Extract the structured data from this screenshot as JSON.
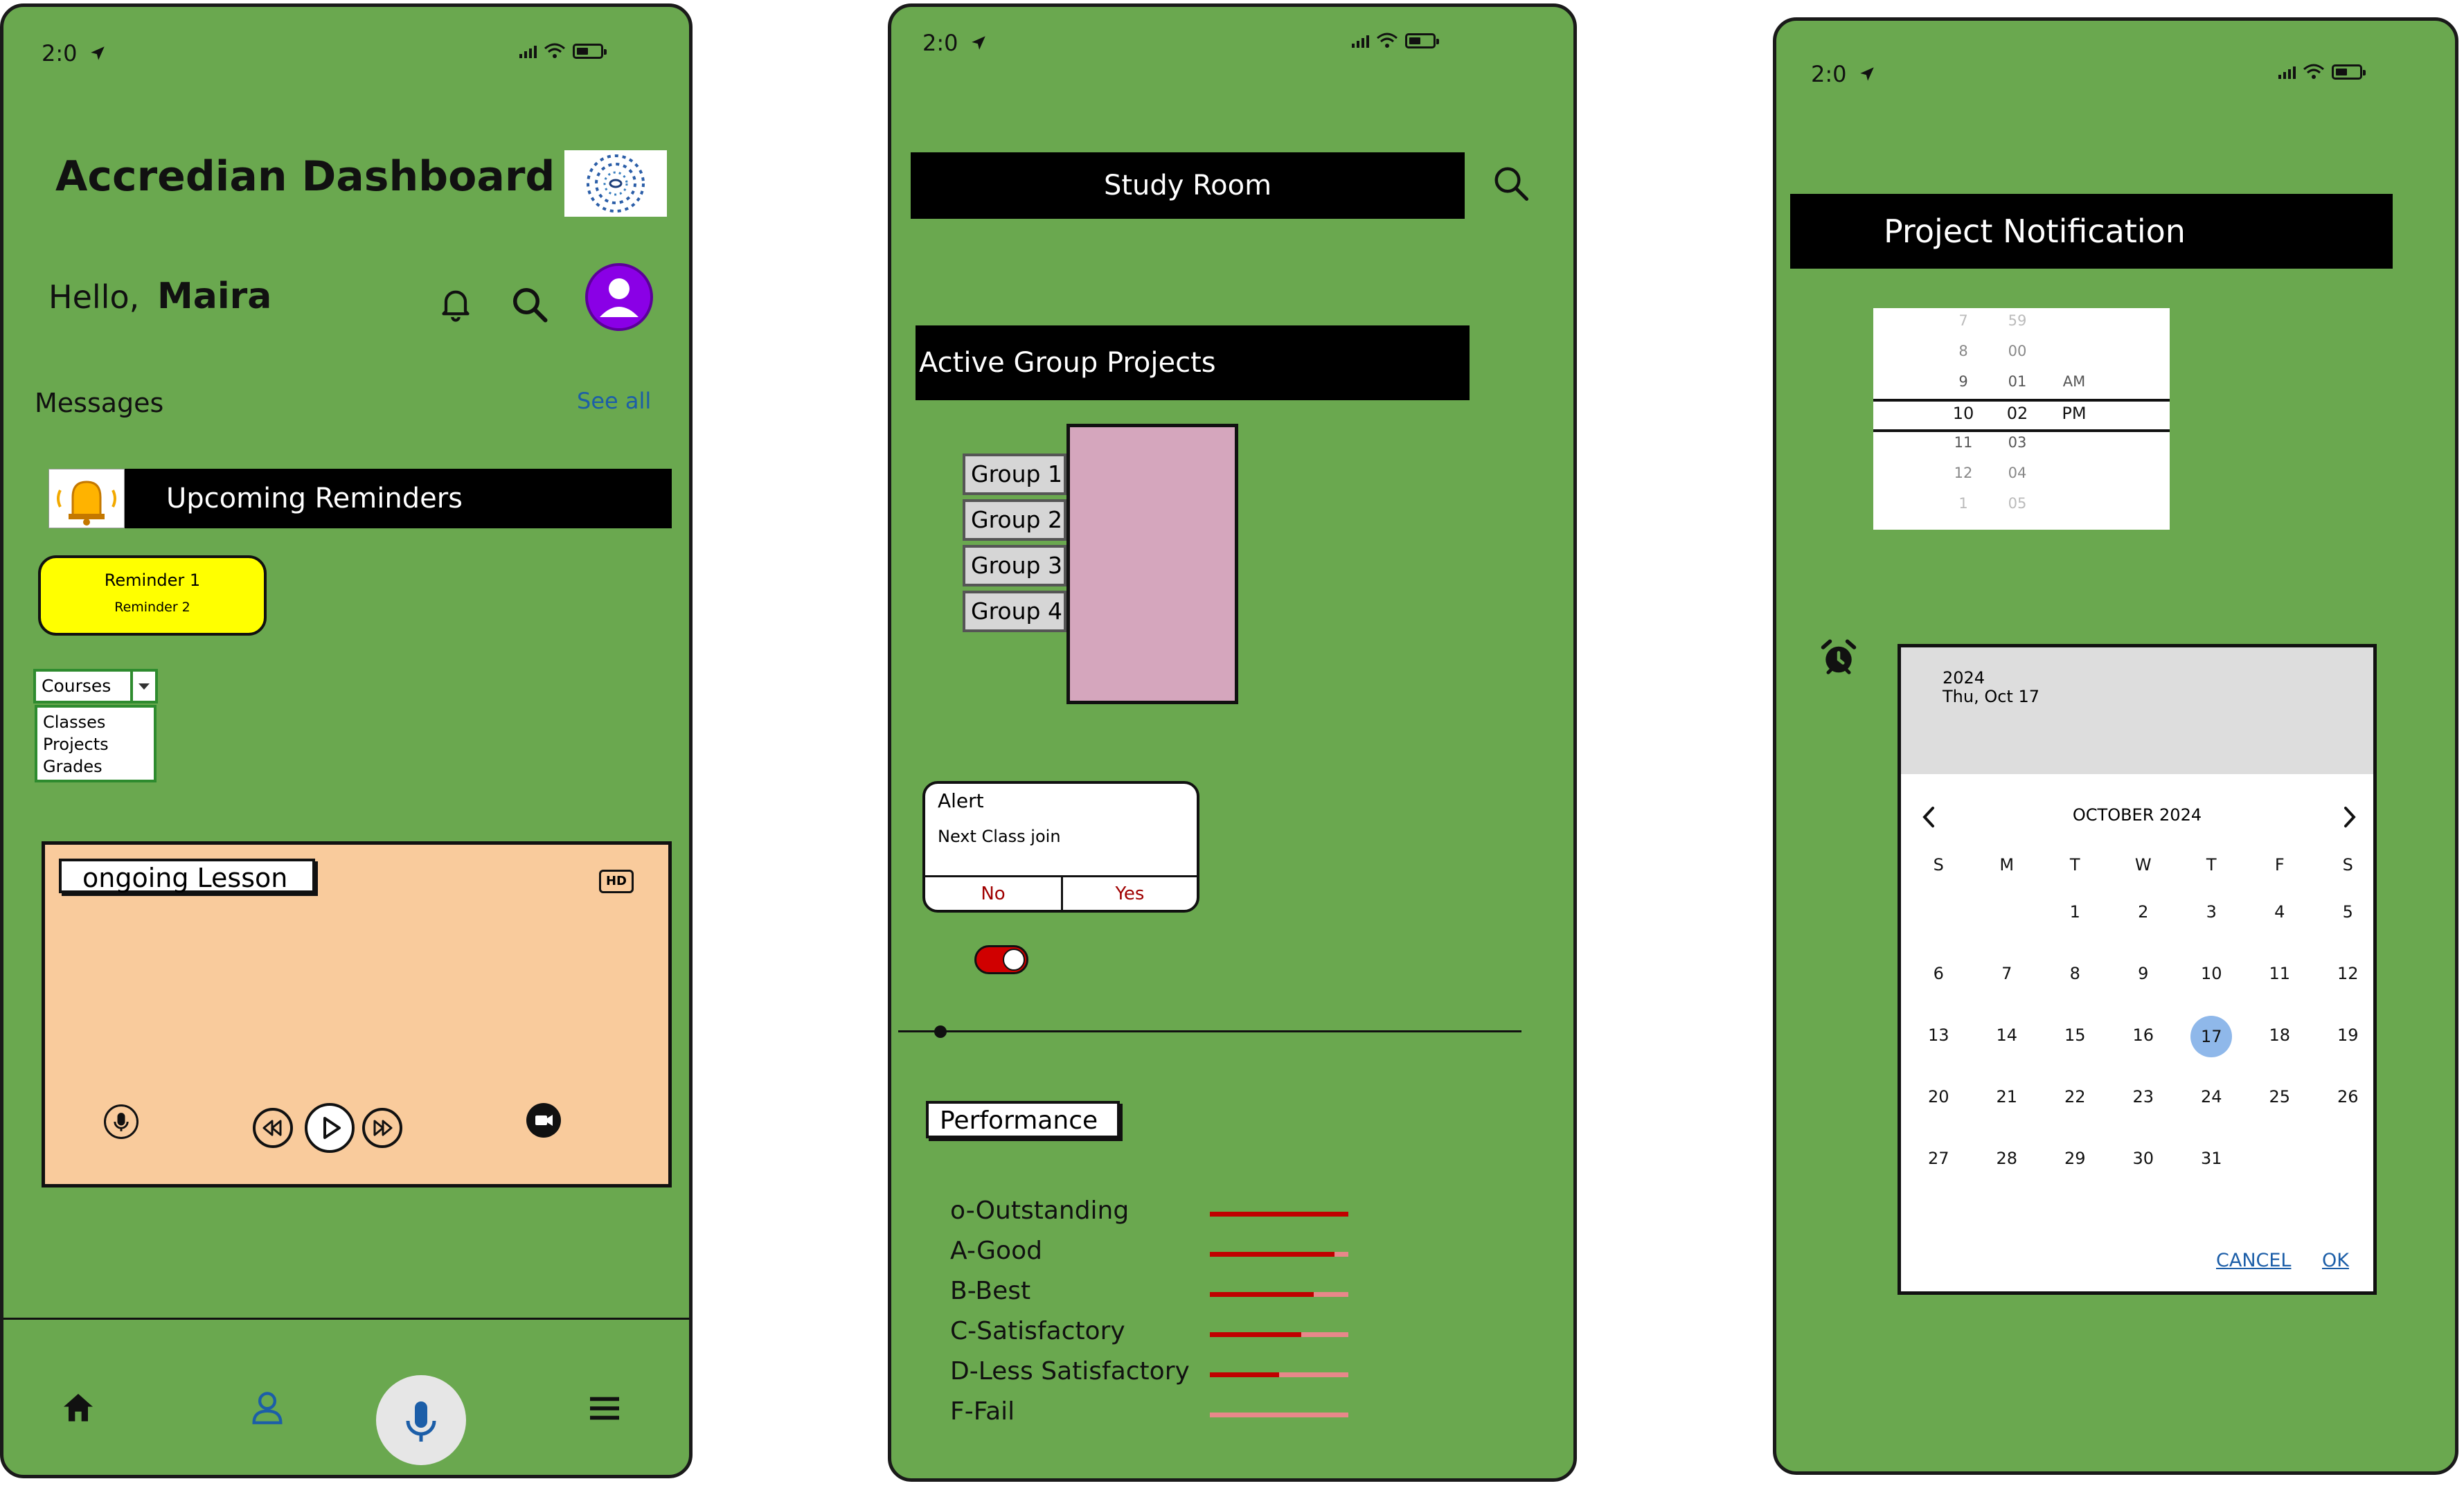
{
  "status_bar": {
    "time": "2:0"
  },
  "dashboard": {
    "title": "Accredian Dashboard",
    "greeting": "Hello,",
    "user_name": "Maira",
    "messages_label": "Messages",
    "see_all": "See all",
    "reminders_title": "Upcoming Reminders",
    "reminders": [
      "Reminder 1",
      "Reminder 2"
    ],
    "dropdown": {
      "selected": "Courses",
      "options": [
        "Classes",
        "Projects",
        "Grades"
      ]
    },
    "lesson": {
      "title": "ongoing Lesson",
      "quality_badge": "HD"
    },
    "bottom_nav": [
      "home-icon",
      "user-icon",
      "mic-icon",
      "menu-icon"
    ]
  },
  "study_room": {
    "title": "Study Room",
    "projects_title": "Active Group Projects",
    "groups": [
      "Group 1",
      "Group 2",
      "Group 3",
      "Group 4"
    ],
    "alert": {
      "title": "Alert",
      "message": "Next Class join",
      "no_label": "No",
      "yes_label": "Yes"
    },
    "toggle_on": true,
    "performance_title": "Performance",
    "performance": [
      {
        "grade": "o-Outstanding",
        "value": 1.0
      },
      {
        "grade": "A-Good",
        "value": 0.9
      },
      {
        "grade": "B-Best",
        "value": 0.75
      },
      {
        "grade": "C-Satisfactory",
        "value": 0.66
      },
      {
        "grade": "D-Less Satisfactory",
        "value": 0.5
      },
      {
        "grade": "F-Fail",
        "value": 0.0
      }
    ],
    "colors": {
      "bar_fill": "#c00000",
      "bar_track": "#e8888a"
    }
  },
  "notification": {
    "title": "Project Notification",
    "time_picker": {
      "hours": [
        "7",
        "8",
        "9",
        "10",
        "11",
        "12",
        "1"
      ],
      "minutes": [
        "59",
        "00",
        "01",
        "02",
        "03",
        "04",
        "05"
      ],
      "periods": [
        "AM",
        "PM"
      ],
      "selected_hour": "10",
      "selected_minute": "02",
      "selected_period": "PM"
    },
    "calendar": {
      "year": "2024",
      "selected_date_label": "Thu, Oct 17",
      "month_label": "OCTOBER 2024",
      "weekdays": [
        "S",
        "M",
        "T",
        "W",
        "T",
        "F",
        "S"
      ],
      "first_weekday_index": 2,
      "days_in_month": 31,
      "selected_day": 17,
      "cancel_label": "CANCEL",
      "ok_label": "OK"
    }
  },
  "colors": {
    "phone_bg": "#6aa84f",
    "lesson_bg": "#f9cb9c",
    "reminder_bg": "#ffff00",
    "group_panel": "#d5a6bd",
    "avatar": "#8a00e6",
    "link": "#1c5ea8"
  }
}
